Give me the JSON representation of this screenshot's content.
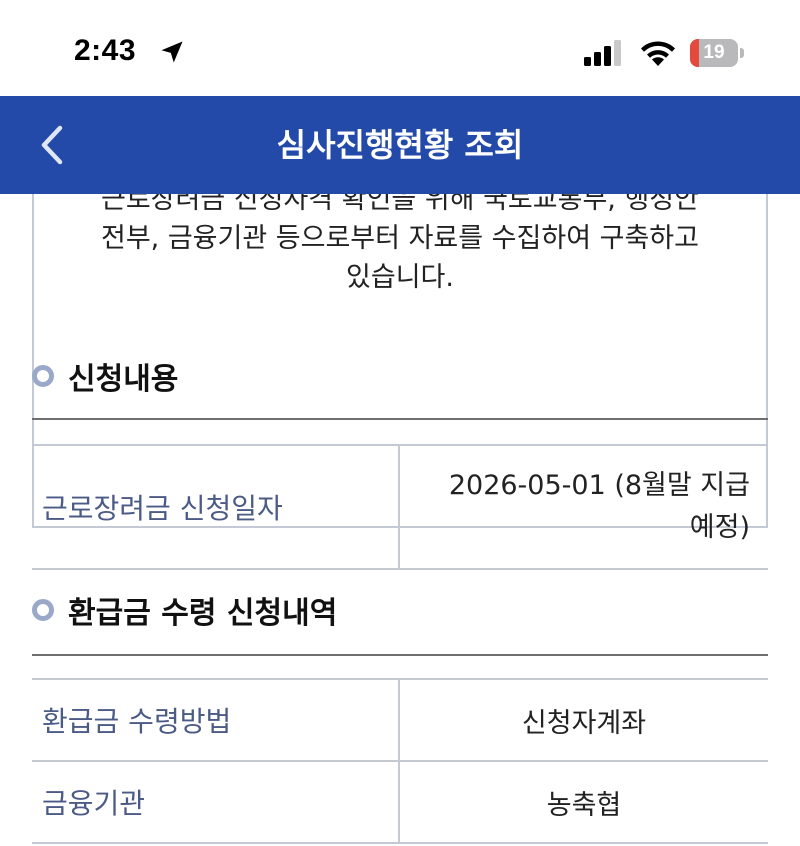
{
  "status_bar": {
    "time": "2:43",
    "battery_level": "19",
    "battery_fraction": 0.19,
    "battery_color": "#e5483d",
    "icons": [
      "location-arrow-icon",
      "cellular-signal-icon",
      "wifi-icon",
      "battery-icon"
    ]
  },
  "header": {
    "title": "심사진행현황 조회",
    "back_icon": "chevron-left-icon",
    "background_color": "#234aa9"
  },
  "notice": {
    "lines": [
      "근로장려금 신청자격 확인을 위해 국토교통부, 행정안",
      "전부, 금융기관 등으로부터 자료를 수집하여 구축하고",
      "있습니다."
    ]
  },
  "sections": {
    "application": {
      "title": "신청내용",
      "rows": [
        {
          "label": "근로장려금 신청일자",
          "value_line1": "2026-05-01 (8월말 지급",
          "value_line2": "예정)"
        }
      ]
    },
    "refund": {
      "title": "환급금 수령 신청내역",
      "rows": [
        {
          "label": "환급금 수령방법",
          "value": "신청자계좌"
        },
        {
          "label": "금융기관",
          "value": "농축협"
        }
      ]
    }
  }
}
